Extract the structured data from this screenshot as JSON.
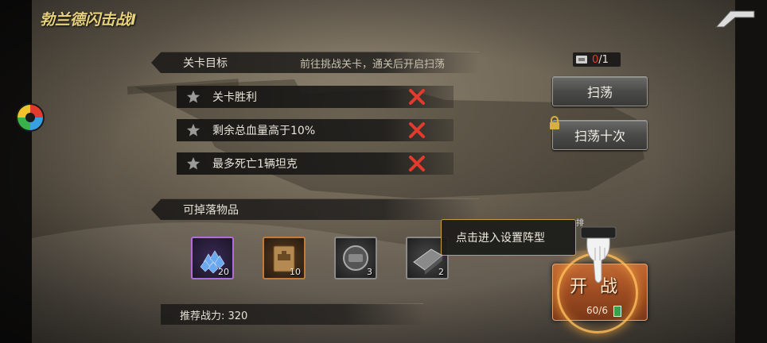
{
  "title": "勃兰德闪击战I",
  "objectives": {
    "header": "关卡目标",
    "hint": "前往挑战关卡，通关后开启扫荡",
    "items": [
      {
        "label": "关卡胜利"
      },
      {
        "label": "剩余总血量高于10%"
      },
      {
        "label": "最多死亡1辆坦克"
      }
    ]
  },
  "drops": {
    "header": "可掉落物品",
    "items": [
      {
        "name": "blue-crystals",
        "count": "20",
        "rarity": "purple"
      },
      {
        "name": "tank-manual",
        "count": "10",
        "rarity": "orange"
      },
      {
        "name": "tank-part",
        "count": "3",
        "rarity": "gray"
      },
      {
        "name": "steel-plate",
        "count": "2",
        "rarity": "gray"
      }
    ]
  },
  "recommended_power": "推荐战力: 320",
  "sweep_tickets": {
    "current": "0",
    "max": "/1"
  },
  "buttons": {
    "sweep": "扫荡",
    "sweep_ten": "扫荡十次",
    "fight": "开战",
    "fight_cost": "60/6"
  },
  "tutorial_tip": "点击进入设置阵型",
  "tutorial_top_hint": "排",
  "colors": {
    "title": "#e8d27a",
    "failed_mark": "#e23b2e",
    "fight_button": "#9e4c22",
    "tip_border": "#c2a040"
  }
}
